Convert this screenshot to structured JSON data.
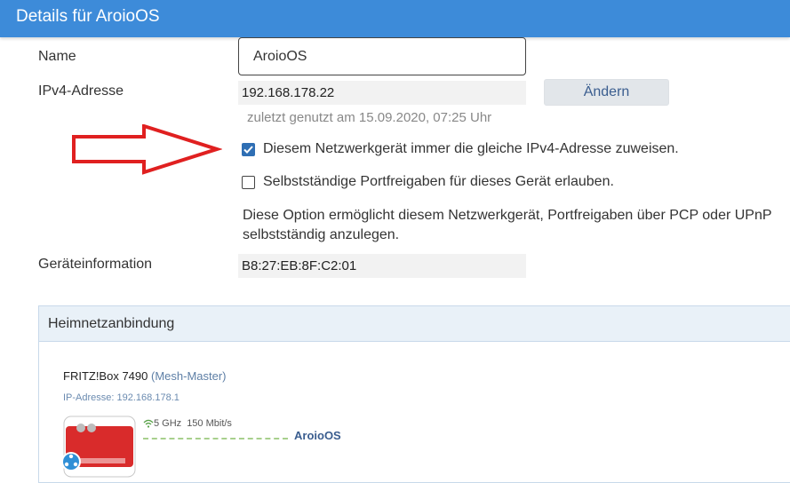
{
  "header": {
    "title": "Details für AroioOS"
  },
  "form": {
    "name_label": "Name",
    "name_value": "AroioOS",
    "ipv4_label": "IPv4-Adresse",
    "ipv4_value": "192.168.178.22",
    "change_button": "Ändern",
    "last_used": "zuletzt genutzt am 15.09.2020, 07:25 Uhr",
    "same_ip_checkbox": {
      "label": "Diesem Netzwerkgerät immer die gleiche IPv4-Adresse zuweisen.",
      "checked": true
    },
    "port_checkbox": {
      "label": "Selbstständige Portfreigaben für dieses Gerät erlauben.",
      "checked": false
    },
    "port_description": "Diese Option ermöglicht diesem Netzwerkgerät, Portfreigaben über PCP oder UPnP selbstständig anzulegen.",
    "device_info_label": "Geräteinformation",
    "device_info_value": "B8:27:EB:8F:C2:01"
  },
  "home_network": {
    "title": "Heimnetzanbindung",
    "device_name": "FRITZ!Box 7490",
    "device_role": "(Mesh-Master)",
    "device_ip": "IP-Adresse: 192.168.178.1",
    "band": "5 GHz",
    "speed": "150 Mbit/s",
    "client": "AroioOS"
  },
  "colors": {
    "header_bg": "#3d8bd9",
    "arrow": "#e02020",
    "checkbox_checked": "#2f6fb4",
    "link_line": "#a8d08d",
    "router_red": "#d92b2b"
  }
}
